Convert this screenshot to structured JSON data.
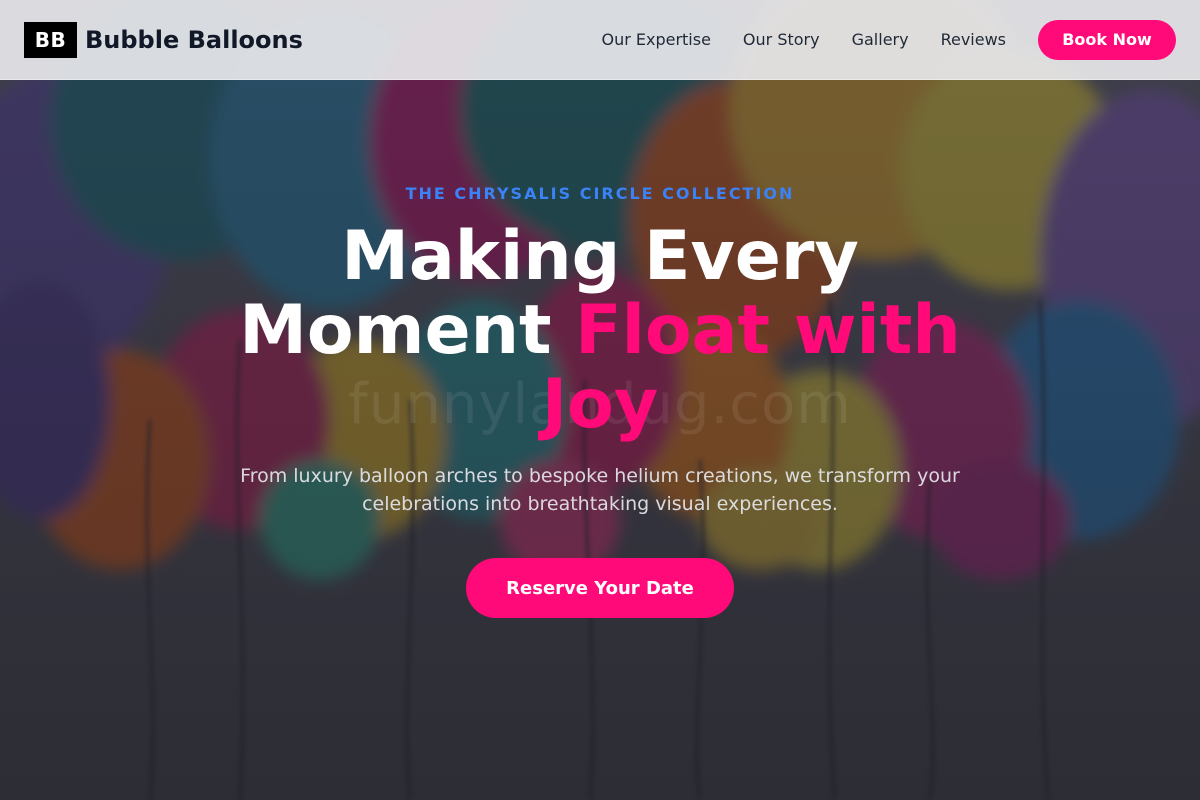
{
  "brand": {
    "logo_mark": "BB",
    "name": "Bubble Balloons"
  },
  "nav": {
    "items": [
      {
        "label": "Our Expertise"
      },
      {
        "label": "Our Story"
      },
      {
        "label": "Gallery"
      },
      {
        "label": "Reviews"
      }
    ],
    "cta_label": "Book Now"
  },
  "hero": {
    "eyebrow": "THE CHRYSALIS CIRCLE COLLECTION",
    "headline_plain": "Making Every Moment ",
    "headline_accent": "Float with Joy",
    "subtitle": "From luxury balloon arches to bespoke helium creations, we transform your celebrations into breathtaking visual experiences.",
    "cta_label": "Reserve Your Date",
    "watermark": "funnylandug.com"
  },
  "colors": {
    "accent_pink": "#ff0a78",
    "eyebrow_blue": "#3b82f6",
    "header_bg": "#e8e8ec",
    "text_dark": "#111827"
  }
}
